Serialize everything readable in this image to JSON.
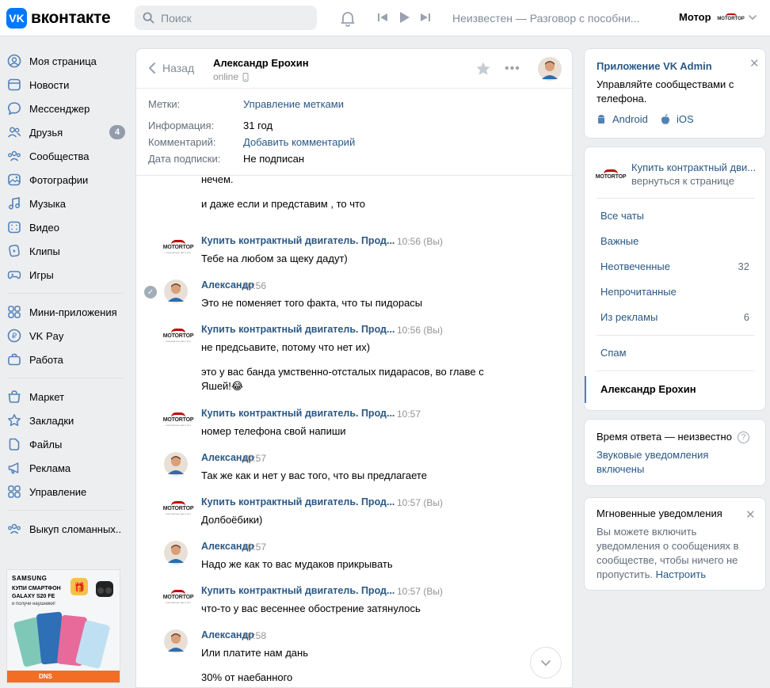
{
  "header": {
    "logo_text": "вконтакте",
    "search_placeholder": "Поиск",
    "now_playing": "Неизвестен — Разговор с пособни...",
    "user_name": "Мотор",
    "user_logo_text": "MOTORTOP"
  },
  "leftnav": {
    "groups": [
      [
        {
          "label": "Моя страница",
          "icon": "user-circle-icon"
        },
        {
          "label": "Новости",
          "icon": "news-icon"
        },
        {
          "label": "Мессенджер",
          "icon": "messenger-icon"
        },
        {
          "label": "Друзья",
          "icon": "friends-icon",
          "count": "4"
        },
        {
          "label": "Сообщества",
          "icon": "communities-icon"
        },
        {
          "label": "Фотографии",
          "icon": "photos-icon"
        },
        {
          "label": "Музыка",
          "icon": "music-icon"
        },
        {
          "label": "Видео",
          "icon": "video-icon"
        },
        {
          "label": "Клипы",
          "icon": "clips-icon"
        },
        {
          "label": "Игры",
          "icon": "games-icon"
        }
      ],
      [
        {
          "label": "Мини-приложения",
          "icon": "mini-apps-icon"
        },
        {
          "label": "VK Pay",
          "icon": "vk-pay-icon"
        },
        {
          "label": "Работа",
          "icon": "work-icon"
        }
      ],
      [
        {
          "label": "Маркет",
          "icon": "market-icon"
        },
        {
          "label": "Закладки",
          "icon": "bookmarks-icon"
        },
        {
          "label": "Файлы",
          "icon": "files-icon"
        },
        {
          "label": "Реклама",
          "icon": "ads-icon"
        },
        {
          "label": "Управление",
          "icon": "manage-icon"
        }
      ],
      [
        {
          "label": "Выкуп сломанных..",
          "icon": "group-icon"
        }
      ]
    ]
  },
  "ad": {
    "brand": "SAMSUNG",
    "line1": "КУПИ СМАРТФОН",
    "line2": "GALAXY S20 FE",
    "line3": "и получи наушники!",
    "store": "DNS"
  },
  "chat": {
    "back_label": "Назад",
    "peer_name": "Александр Ерохин",
    "peer_status": "online",
    "meta": [
      {
        "key": "Метки:",
        "value": "Управление метками",
        "link": true
      },
      {
        "key": "Информация:",
        "value": "31 год",
        "link": false
      },
      {
        "key": "Комментарий:",
        "value": "Добавить комментарий",
        "link": true
      },
      {
        "key": "Дата подписки:",
        "value": "Не подписан",
        "link": false
      }
    ],
    "messages": [
      {
        "kind": "cont",
        "lines": [
          "нечем.",
          "",
          "и даже если и представим , то что"
        ]
      },
      {
        "kind": "page",
        "sender": "Купить контрактный двигатель. Прод...",
        "time": "10:56 (Вы)",
        "lines": [
          "Тебе на любом за щеку дадут)"
        ]
      },
      {
        "kind": "user",
        "sender": "Александр",
        "time": "10:56",
        "check": true,
        "lines": [
          "Это не поменяет того факта, что ты пидорасы"
        ]
      },
      {
        "kind": "page",
        "sender": "Купить контрактный двигатель. Прод...",
        "time": "10:56 (Вы)",
        "lines": [
          "не предсьавите, потому что нет их)",
          "",
          "это у вас банда умственно-отсталых пидарасов, во главе с",
          "Яшей!😂"
        ]
      },
      {
        "kind": "page",
        "sender": "Купить контрактный двигатель. Прод...",
        "time": "10:57",
        "lines": [
          "номер телефона свой напиши"
        ]
      },
      {
        "kind": "user",
        "sender": "Александр",
        "time": "10:57",
        "lines": [
          "Так же как и нет у вас того, что вы предлагаете"
        ]
      },
      {
        "kind": "page",
        "sender": "Купить контрактный двигатель. Прод...",
        "time": "10:57 (Вы)",
        "lines": [
          "Долбоёбики)"
        ]
      },
      {
        "kind": "user",
        "sender": "Александр",
        "time": "10:57",
        "lines": [
          "Надо же как то вас мудаков прикрывать"
        ]
      },
      {
        "kind": "page",
        "sender": "Купить контрактный двигатель. Прод...",
        "time": "10:57 (Вы)",
        "lines": [
          "что-то у вас весеннее обострение затянулось"
        ]
      },
      {
        "kind": "user",
        "sender": "Александр",
        "time": "10:58",
        "lines": [
          "Или платите нам дань",
          "",
          "30% от наебанного"
        ]
      }
    ]
  },
  "right": {
    "vk_admin": {
      "title": "Приложение VK Admin",
      "desc": "Управляйте сообществами с телефона.",
      "android": "Android",
      "ios": "iOS"
    },
    "community": {
      "name": "Купить контрактный дви...",
      "sub": "вернуться к странице"
    },
    "filters": [
      {
        "label": "Все чаты",
        "count": ""
      },
      {
        "label": "Важные",
        "count": ""
      },
      {
        "label": "Неотвеченные",
        "count": "32"
      },
      {
        "label": "Непрочитанные",
        "count": ""
      },
      {
        "label": "Из рекламы",
        "count": "6"
      }
    ],
    "spam": "Спам",
    "active_chat": "Александр Ерохин",
    "response": {
      "time_label": "Время ответа — неизвестно",
      "sound_link": "Звуковые уведомления включены"
    },
    "instant": {
      "title": "Мгновенные уведомления",
      "desc": "Вы можете включить уведомления о сообщениях в сообществе, чтобы ничего не пропустить.",
      "link": "Настроить"
    }
  },
  "colors": {
    "accent": "#2a5885",
    "vk_blue": "#0077ff",
    "background": "#edeef0",
    "brand_red": "#c40000"
  }
}
